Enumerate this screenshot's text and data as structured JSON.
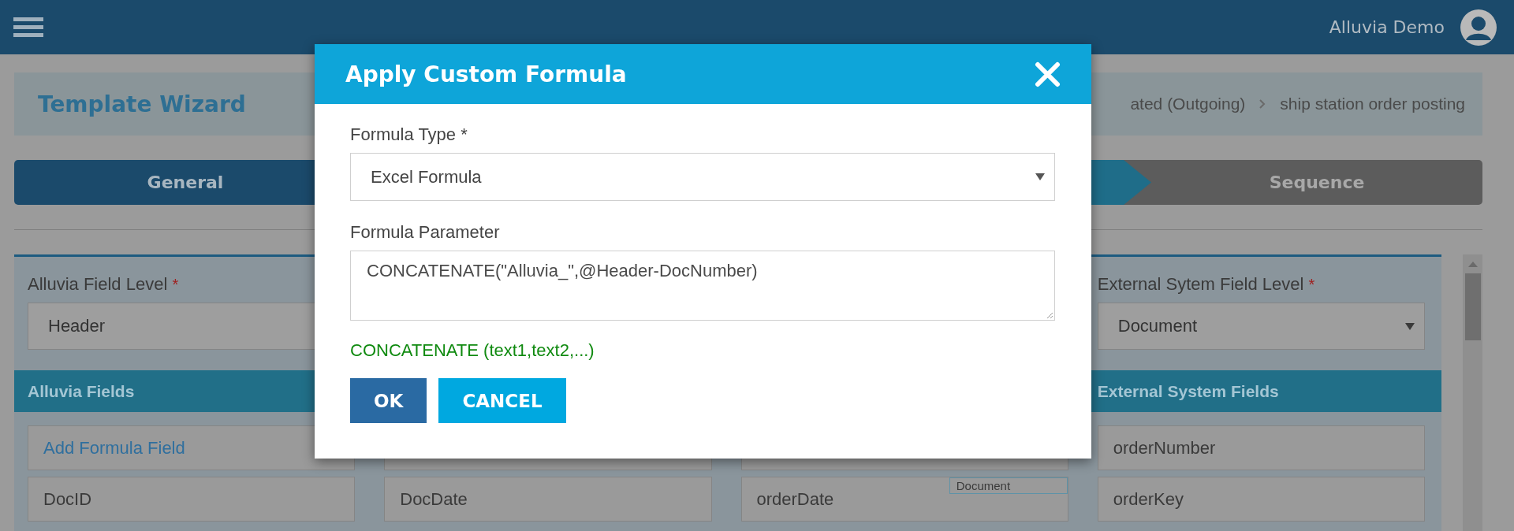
{
  "top_bar": {
    "user_name": "Alluvia Demo"
  },
  "page_title": "Template Wizard",
  "breadcrumb": [
    "ated (Outgoing)",
    "ship station order posting"
  ],
  "wizard_steps": [
    {
      "label": "General",
      "kind": "complete"
    },
    {
      "kind": "current"
    },
    {
      "label": "Sequence",
      "kind": "upcoming"
    }
  ],
  "mapping_panel": {
    "left_level": {
      "label": "Alluvia Field Level",
      "required_mark": "*",
      "value": "Header"
    },
    "right_level": {
      "label": "External Sytem Field Level",
      "required_mark": "*",
      "value": "Document"
    },
    "left_header": "Alluvia Fields",
    "right_header": "External System Fields",
    "rows": [
      {
        "cells": [
          {
            "kind": "link",
            "text": "Add Formula Field"
          },
          {
            "kind": "blank"
          },
          {
            "kind": "blank"
          },
          {
            "kind": "field",
            "text": "orderNumber"
          }
        ]
      },
      {
        "cells": [
          {
            "kind": "field",
            "text": "DocID"
          },
          {
            "kind": "field",
            "text": "DocDate"
          },
          {
            "kind": "field",
            "text": "orderDate",
            "tag": "Document"
          },
          {
            "kind": "field",
            "text": "orderKey"
          }
        ]
      }
    ]
  },
  "modal": {
    "title": "Apply Custom Formula",
    "fields": [
      {
        "kind": "select",
        "label": "Formula Type *",
        "value": "Excel Formula"
      },
      {
        "kind": "textarea",
        "label": "Formula Parameter",
        "value": "CONCATENATE(\"Alluvia_\",@Header-DocNumber)"
      }
    ],
    "hint": "CONCATENATE (text1,text2,...)",
    "buttons": [
      {
        "kind": "primary",
        "label": "OK"
      },
      {
        "kind": "secondary",
        "label": "CANCEL"
      }
    ]
  }
}
